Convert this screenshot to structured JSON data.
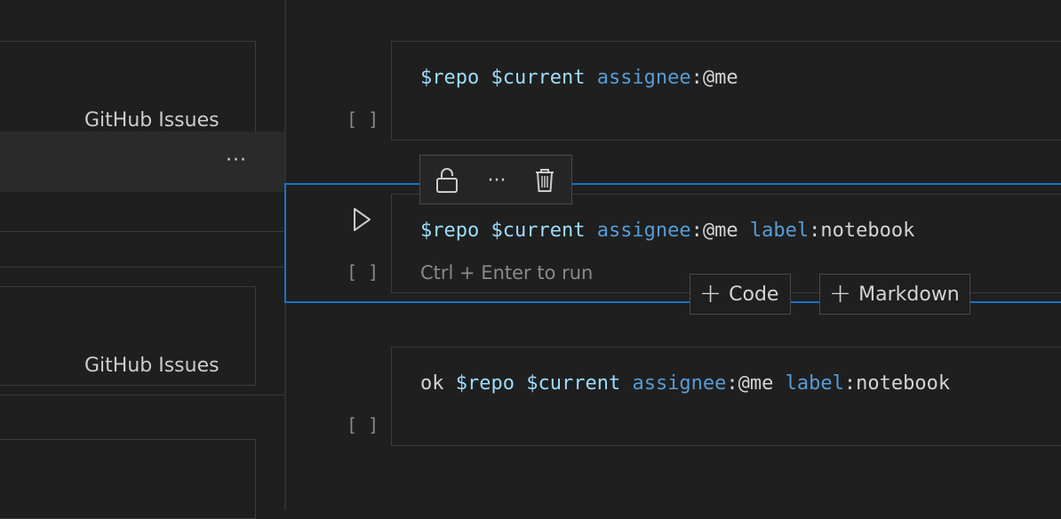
{
  "sidebar": {
    "items": [
      {
        "label": "GitHub Issues"
      },
      {
        "label": "GitHub Issues"
      }
    ],
    "more_label": "···"
  },
  "notebook": {
    "cells": [
      {
        "exec_label": "[ ]",
        "tokens": [
          {
            "t": "var",
            "v": "$repo"
          },
          {
            "t": "plain",
            "v": " "
          },
          {
            "t": "var",
            "v": "$current"
          },
          {
            "t": "plain",
            "v": " "
          },
          {
            "t": "key",
            "v": "assignee"
          },
          {
            "t": "plain",
            "v": ":@me"
          }
        ]
      },
      {
        "exec_label": "[ ]",
        "hint": "Ctrl + Enter to run",
        "tokens": [
          {
            "t": "var",
            "v": "$repo"
          },
          {
            "t": "plain",
            "v": " "
          },
          {
            "t": "var",
            "v": "$current"
          },
          {
            "t": "plain",
            "v": " "
          },
          {
            "t": "key",
            "v": "assignee"
          },
          {
            "t": "plain",
            "v": ":@me "
          },
          {
            "t": "key",
            "v": "label"
          },
          {
            "t": "plain",
            "v": ":notebook"
          }
        ]
      },
      {
        "exec_label": "[ ]",
        "tokens": [
          {
            "t": "plain",
            "v": "ok "
          },
          {
            "t": "var",
            "v": "$repo"
          },
          {
            "t": "plain",
            "v": " "
          },
          {
            "t": "var",
            "v": "$current"
          },
          {
            "t": "plain",
            "v": " "
          },
          {
            "t": "key",
            "v": "assignee"
          },
          {
            "t": "plain",
            "v": ":@me "
          },
          {
            "t": "key",
            "v": "label"
          },
          {
            "t": "plain",
            "v": ":notebook"
          }
        ]
      }
    ],
    "toolbar": {
      "lock_icon": "unlock-icon",
      "more_label": "···",
      "delete_icon": "trash-icon"
    },
    "add_code_label": "Code",
    "add_markdown_label": "Markdown"
  },
  "colors": {
    "background": "#1f1f1f",
    "focus_border": "#1a73c8",
    "variable": "#9cdcfe",
    "keyword": "#569cd6",
    "text": "#d4d4d4",
    "muted": "#8a8a8a"
  }
}
